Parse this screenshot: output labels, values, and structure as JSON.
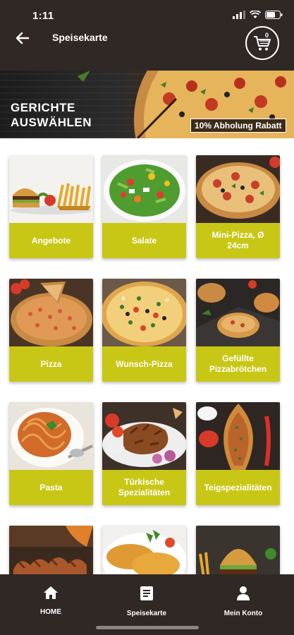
{
  "status_bar": {
    "time": "1:11"
  },
  "header": {
    "title": "Speisekarte",
    "cart_count": "0"
  },
  "banner": {
    "title": "GERICHTE AUSWÄHLEN",
    "badge": "10% Abholung Rabatt"
  },
  "categories": [
    {
      "label": "Angebote",
      "icon": "burger-fries-image"
    },
    {
      "label": "Salate",
      "icon": "salad-bowl-image"
    },
    {
      "label": "Mini-Pizza, Ø 24cm",
      "icon": "mini-pizza-image"
    },
    {
      "label": "Pizza",
      "icon": "pizza-image"
    },
    {
      "label": "Wunsch-Pizza",
      "icon": "custom-pizza-image"
    },
    {
      "label": "Gefüllte Pizzabrötchen",
      "icon": "stuffed-rolls-image"
    },
    {
      "label": "Pasta",
      "icon": "spaghetti-image"
    },
    {
      "label": "Türkische Spezialitäten",
      "icon": "doner-image"
    },
    {
      "label": "Teigspezialitäten",
      "icon": "pide-image"
    },
    {
      "label": "",
      "icon": "grill-meat-image"
    },
    {
      "label": "",
      "icon": "schnitzel-image"
    },
    {
      "label": "",
      "icon": "burger-image"
    }
  ],
  "bottom_nav": {
    "home": "HOME",
    "menu": "Speisekarte",
    "account": "Mein Konto"
  },
  "colors": {
    "header_bg": "#2f2825",
    "accent": "#c9c716"
  }
}
